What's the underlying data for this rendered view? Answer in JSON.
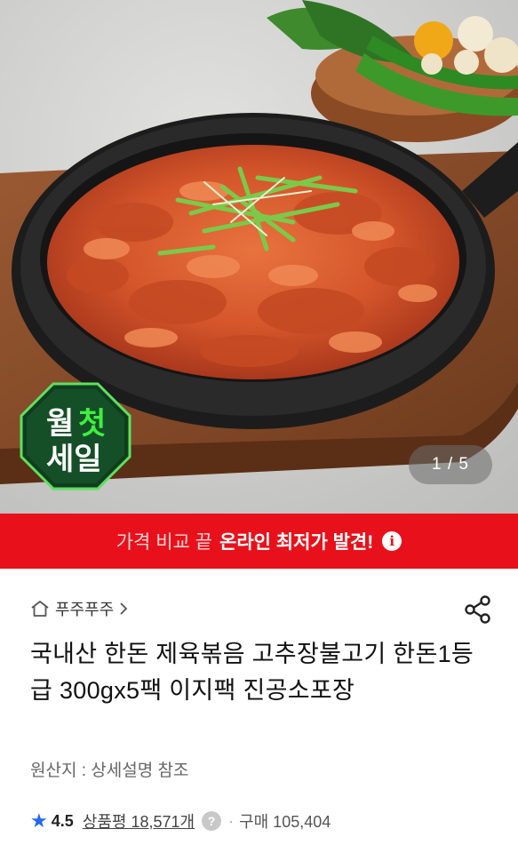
{
  "hero": {
    "image_alt_name": "stir-fried-pork-product-photo",
    "page_counter": "1 / 5",
    "badge": {
      "line1_left": "월",
      "line1_right": "첫",
      "line2": "세일"
    }
  },
  "promo": {
    "part1": "가격 비교 끝",
    "part2": "온라인 최저가 발견!",
    "icon": "info-icon",
    "color": "#e8111b"
  },
  "store": {
    "icon": "home-icon",
    "name": "푸주푸주",
    "chevron": "chevron-right-icon"
  },
  "share": {
    "icon": "share-icon"
  },
  "product": {
    "title": "국내산 한돈 제육볶음 고추장불고기 한돈1등급 300gx5팩 이지팩 진공소포장",
    "origin": "원산지 : 상세설명 참조"
  },
  "rating": {
    "star_icon": "star-icon",
    "score": "4.5",
    "review_label": "상품평 18,571개",
    "help_icon": "question-icon",
    "separator": "·",
    "purchase_label": "구매 105,404",
    "accent": "#2468f2"
  }
}
